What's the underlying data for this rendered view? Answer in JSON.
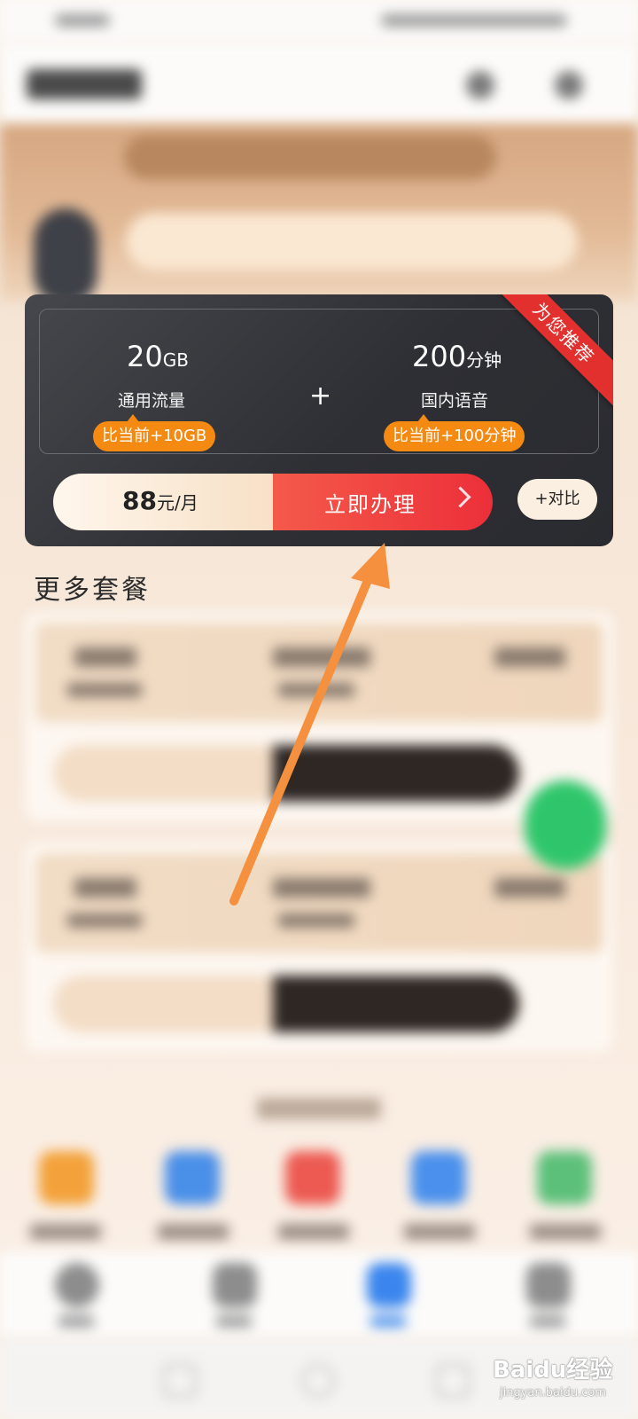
{
  "recommend": {
    "ribbon": "为您推荐",
    "data": {
      "amount": "20",
      "unit": "GB",
      "label": "通用流量",
      "badge": "比当前+10GB"
    },
    "plus": "+",
    "voice": {
      "amount": "200",
      "unit": "分钟",
      "label": "国内语音",
      "badge": "比当前+100分钟"
    },
    "price": {
      "amount": "88",
      "unit": "元/月"
    },
    "apply_label": "立即办理",
    "compare_label": "+对比"
  },
  "more_packages_title": "更多套餐",
  "watermark": {
    "brand": "Baidu经验",
    "sub": "jingyan.baidu.com"
  },
  "colors": {
    "accent_orange": "#f58a12",
    "apply_red": "#ec2f3a",
    "annotation_arrow": "#f5913e"
  }
}
